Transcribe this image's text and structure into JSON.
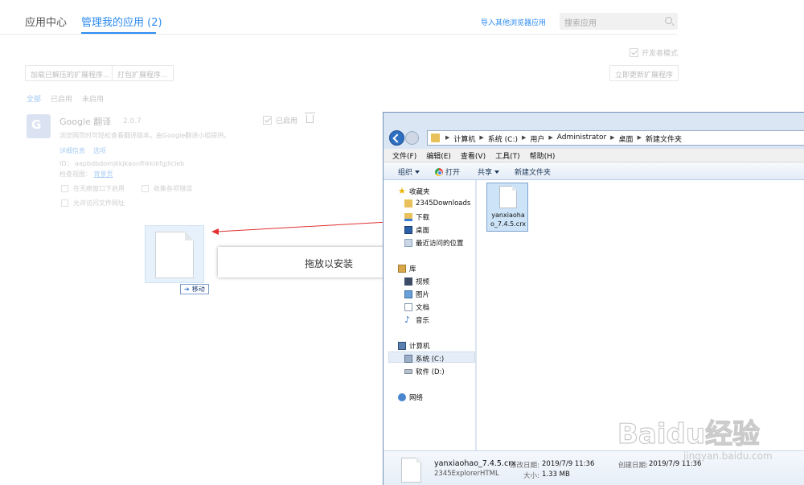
{
  "browser": {
    "tab_app_center": "应用中心",
    "tab_manage": "管理我的应用 (2)",
    "import_link": "导入其他浏览器应用",
    "search_placeholder": "搜索应用",
    "dev_mode_label": "开发者模式",
    "load_unpacked": "加载已解压的扩展程序...",
    "pack_extension": "打包扩展程序...",
    "update_now": "立即更新扩展程序",
    "filters": [
      "全部",
      "已启用",
      "未启用"
    ],
    "extension": {
      "name": "Google 翻译",
      "version": "2.0.7",
      "description": "浏览网页时可轻松查看翻译版本。由Google翻译小组提供。",
      "details_link": "详细信息",
      "options_link": "选项",
      "id": "ID： aapbdbdomjkkjkaonfhkkikfgjllcleb",
      "inspect_label": "检查视图：",
      "inspect_link": "背景页",
      "enabled_label": "已启用",
      "option_incognito": "在无痕窗口下启用",
      "option_errors": "收集各项错误",
      "option_file_urls": "允许访问文件网址"
    },
    "drop_hint": "拖放以安装",
    "drag_badge": "移动"
  },
  "explorer": {
    "breadcrumb": [
      "计算机",
      "系统 (C:)",
      "用户",
      "Administrator",
      "桌面",
      "新建文件夹"
    ],
    "menu": [
      "文件(F)",
      "编辑(E)",
      "查看(V)",
      "工具(T)",
      "帮助(H)"
    ],
    "toolbar": {
      "organize": "组织",
      "open": "打开",
      "share": "共享",
      "new_folder": "新建文件夹"
    },
    "nav": {
      "favorites": "收藏夹",
      "downloads_2345": "2345Downloads",
      "downloads": "下载",
      "desktop": "桌面",
      "recent": "最近访问的位置",
      "libraries": "库",
      "videos": "视频",
      "pictures": "图片",
      "documents": "文档",
      "music": "音乐",
      "computer": "计算机",
      "drive_c": "系统 (C:)",
      "drive_d": "软件 (D:)",
      "network": "网络"
    },
    "file": {
      "name_line1": "yanxiaoha",
      "name_line2": "o_7.4.5.crx"
    },
    "details": {
      "name": "yanxiaohao_7.4.5.crx",
      "type": "2345ExplorerHTML",
      "modified_label": "修改日期:",
      "modified_value": "2019/7/9 11:36",
      "size_label": "大小:",
      "size_value": "1.33 MB",
      "created_label": "创建日期:",
      "created_value": "2019/7/9 11:36"
    }
  },
  "watermark": {
    "brand": "Baidu经验",
    "site": "jingyan.baidu.com"
  }
}
